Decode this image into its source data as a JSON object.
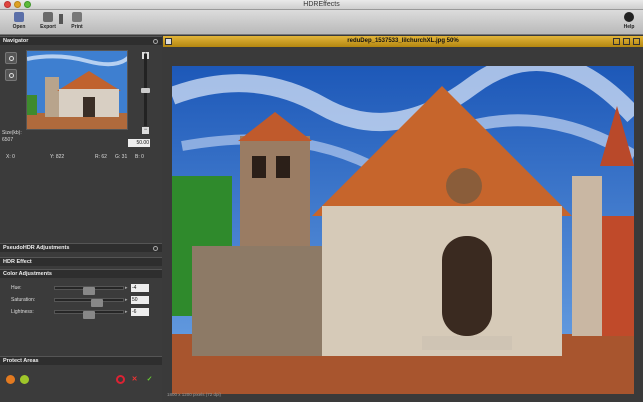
{
  "app": {
    "title": "HDREffects"
  },
  "toolbar": {
    "open": "Open",
    "export": "Export",
    "print": "Print",
    "help": "Help"
  },
  "navigator": {
    "title": "Navigator",
    "zoom_value": "50.00",
    "size_label": "Size(kb):",
    "size_value": "6507",
    "x": "X: 0",
    "y": "Y: 822",
    "r": "R: 62",
    "g": "G: 31",
    "b": "B: 0"
  },
  "sections": {
    "pseudo": "PseudoHDR Adjustments",
    "hdr": "HDR Effect",
    "color": "Color Adjustments",
    "protect": "Protect Areas"
  },
  "adjustments": [
    {
      "label": "Hue:",
      "value": "-4",
      "level": 0.49
    },
    {
      "label": "Saturation:",
      "value": "50",
      "level": 0.62
    },
    {
      "label": "Lightness:",
      "value": "-6",
      "level": 0.48
    }
  ],
  "document": {
    "title": "reduDep_1537533_lilchurchXL.jpg 50%",
    "status": "1800 x 1200 pixels (72 dpi)"
  },
  "colors": {
    "accent": "#d4a521",
    "panel": "#3b3b3b",
    "sky": "#2c6fc4"
  }
}
